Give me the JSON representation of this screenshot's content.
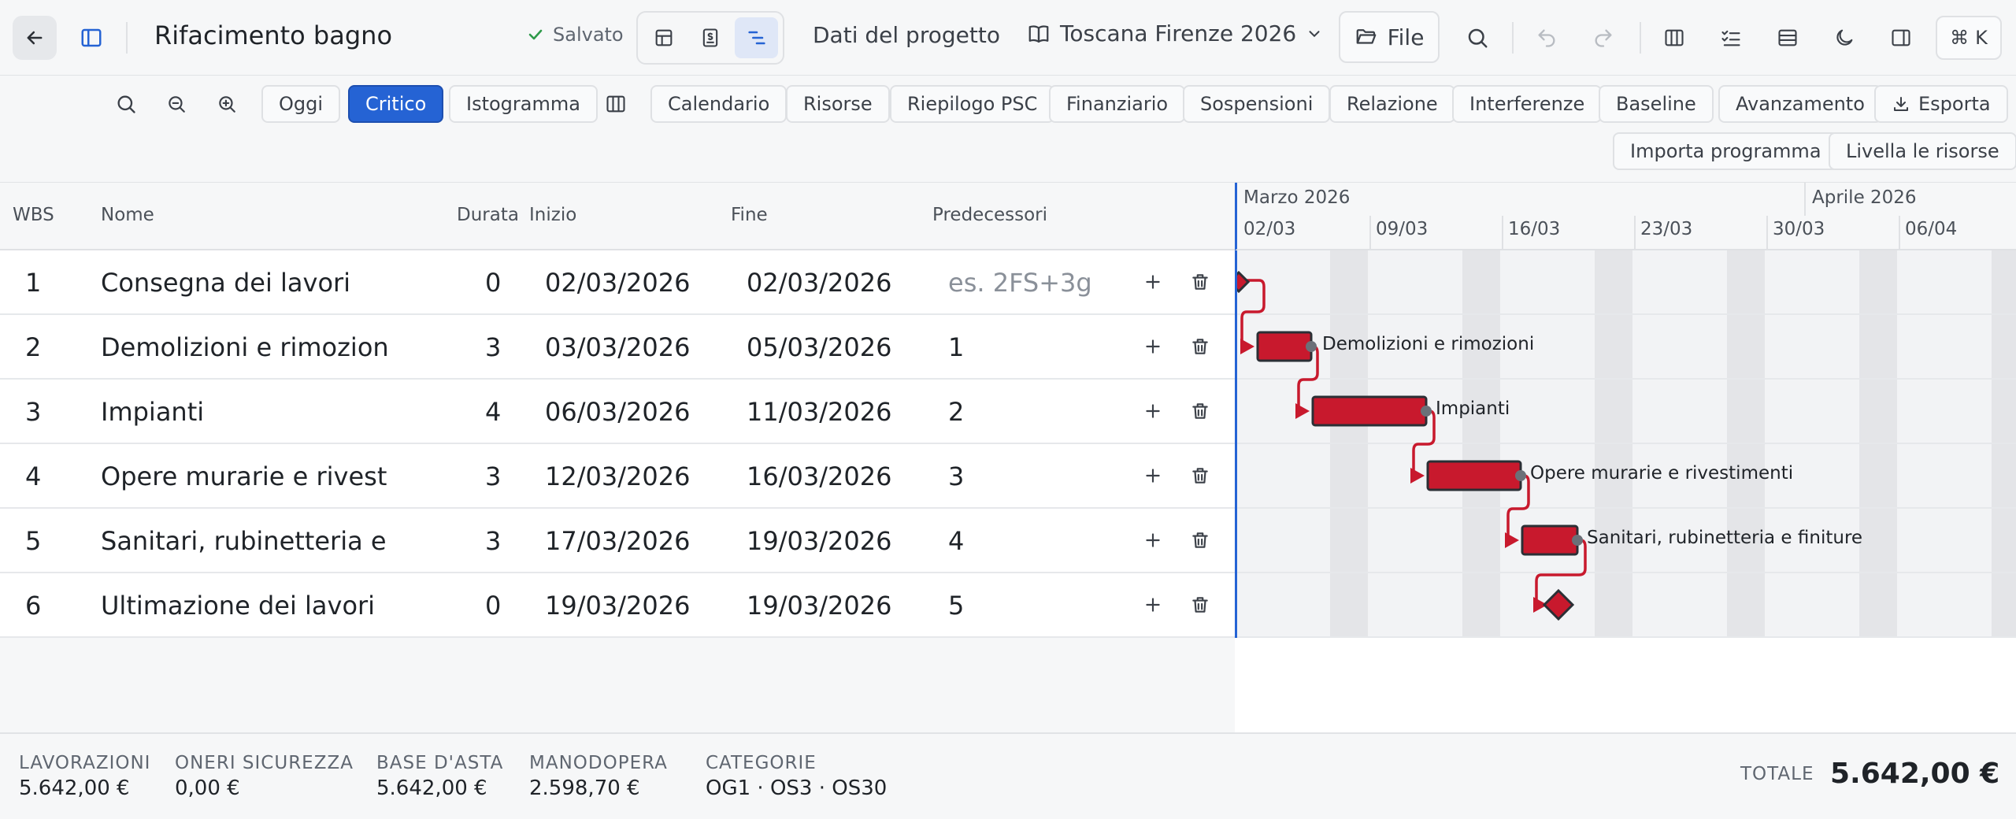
{
  "topbar": {
    "title": "Rifacimento bagno",
    "saved_label": "Salvato",
    "project_data_label": "Dati del progetto",
    "project_name": "Toscana Firenze 2026",
    "file_label": "File",
    "shortcut_key": "K"
  },
  "toolbar": {
    "today": "Oggi",
    "critical": "Critico",
    "histogram": "Istogramma",
    "calendar": "Calendario",
    "resources": "Risorse",
    "psc_summary": "Riepilogo PSC",
    "financial": "Finanziario",
    "suspensions": "Sospensioni",
    "report": "Relazione",
    "interferences": "Interferenze",
    "baseline": "Baseline",
    "progress": "Avanzamento",
    "export": "Esporta",
    "import_schedule": "Importa programma",
    "level_resources": "Livella le risorse"
  },
  "table": {
    "headers": {
      "wbs": "WBS",
      "name": "Nome",
      "duration": "Durata",
      "start": "Inizio",
      "end": "Fine",
      "predecessors": "Predecessori"
    },
    "predecessor_placeholder": "es. 2FS+3g",
    "rows": [
      {
        "wbs": "1",
        "name": "Consegna dei lavori",
        "duration": "0",
        "start": "02/03/2026",
        "end": "02/03/2026",
        "pred": ""
      },
      {
        "wbs": "2",
        "name": "Demolizioni e rimozion",
        "duration": "3",
        "start": "03/03/2026",
        "end": "05/03/2026",
        "pred": "1"
      },
      {
        "wbs": "3",
        "name": "Impianti",
        "duration": "4",
        "start": "06/03/2026",
        "end": "11/03/2026",
        "pred": "2"
      },
      {
        "wbs": "4",
        "name": "Opere murarie e rivest",
        "duration": "3",
        "start": "12/03/2026",
        "end": "16/03/2026",
        "pred": "3"
      },
      {
        "wbs": "5",
        "name": "Sanitari, rubinetteria e",
        "duration": "3",
        "start": "17/03/2026",
        "end": "19/03/2026",
        "pred": "4"
      },
      {
        "wbs": "6",
        "name": "Ultimazione dei lavori",
        "duration": "0",
        "start": "19/03/2026",
        "end": "19/03/2026",
        "pred": "5"
      }
    ]
  },
  "gantt": {
    "months": [
      "Marzo 2026",
      "Aprile 2026"
    ],
    "weeks": [
      "02/03",
      "09/03",
      "16/03",
      "23/03",
      "30/03",
      "06/04"
    ],
    "bar_labels": [
      "Demolizioni e rimozioni",
      "Impianti",
      "Opere murarie e rivestimenti",
      "Sanitari, rubinetteria e finiture"
    ],
    "critical_color": "#c8192d"
  },
  "footer": {
    "lavorazioni_label": "LAVORAZIONI",
    "lavorazioni_value": "5.642,00 €",
    "oneri_label": "ONERI SICUREZZA",
    "oneri_value": "0,00 €",
    "base_label": "BASE D'ASTA",
    "base_value": "5.642,00 €",
    "manodopera_label": "MANODOPERA",
    "manodopera_value": "2.598,70 €",
    "categorie_label": "CATEGORIE",
    "categorie_value": "OG1 · OS3 · OS30",
    "total_label": "TOTALE",
    "total_value": "5.642,00 €"
  }
}
